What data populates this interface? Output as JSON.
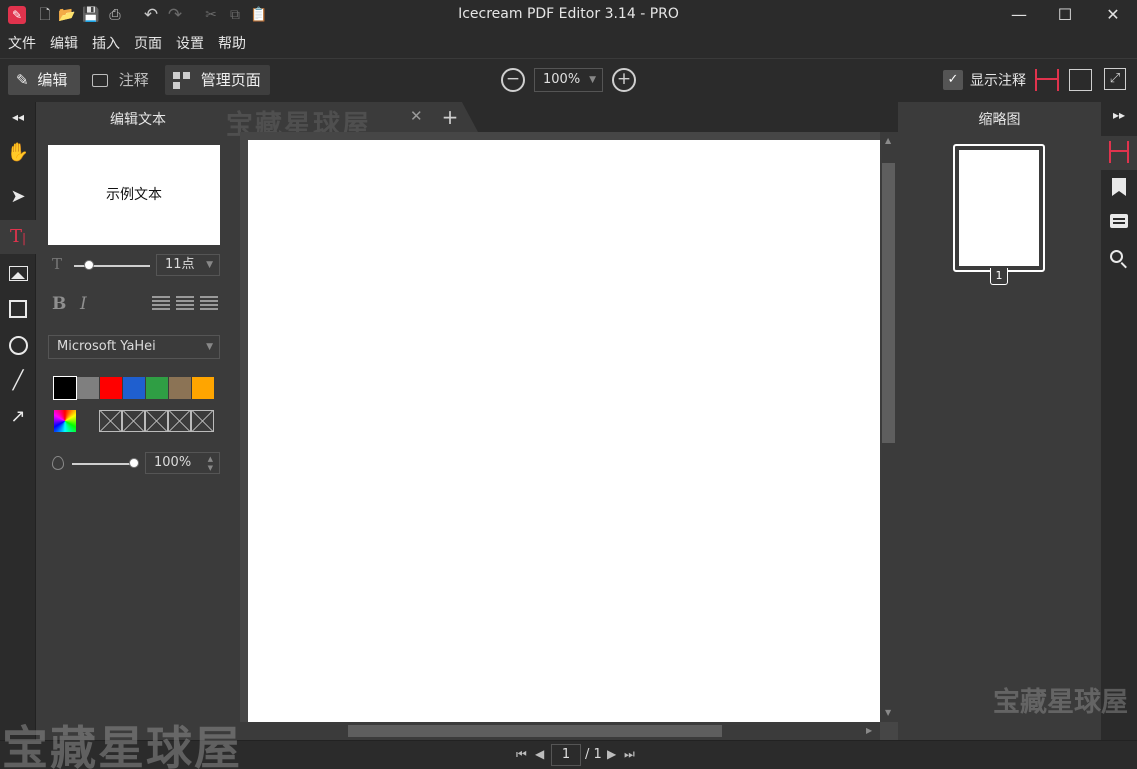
{
  "window": {
    "title": "Icecream PDF Editor 3.14 - PRO",
    "minimize": "—",
    "maximize": "☐",
    "close": "✕"
  },
  "quick_access": [
    "app-logo-icon",
    "new-file-icon",
    "open-folder-icon",
    "save-icon",
    "print-icon",
    "undo-icon",
    "redo-icon",
    "cut-icon",
    "copy-icon",
    "paste-icon"
  ],
  "menu": [
    "文件",
    "编辑",
    "插入",
    "页面",
    "设置",
    "帮助"
  ],
  "toolbar": {
    "edit_label": "编辑",
    "annotate_label": "注释",
    "manage_pages_label": "管理页面",
    "zoom_value": "100%",
    "zoom_out": "−",
    "zoom_in": "+",
    "show_annotations_label": "显示注释"
  },
  "tools": [
    "hand-icon",
    "select-arrow-icon",
    "text-tool-icon",
    "image-icon",
    "rectangle-icon",
    "ellipse-icon",
    "line-icon",
    "arrow-icon"
  ],
  "left_panel": {
    "collapse_glyph": "◂◂",
    "title": "编辑文本",
    "sample_text": "示例文本",
    "font_size_value": "11点",
    "font_size_level": 0.2,
    "bold_label": "B",
    "italic_label": "I",
    "font_family_value": "Microsoft YaHei",
    "colors": [
      "#000000",
      "#7f7f7f",
      "#ff0000",
      "#1f5fcf",
      "#2f9e44",
      "#8b7355",
      "#ffa500"
    ],
    "opacity_value": "100%",
    "opacity_level": 1.0
  },
  "tabs": {
    "active_close": "✕",
    "add": "+"
  },
  "right_panel": {
    "expand_glyph": "▸▸",
    "title": "缩略图",
    "thumb_page_number": "1"
  },
  "status": {
    "current_page": "1",
    "total_pages": "/ 1"
  },
  "watermarks": {
    "tab": "宝藏星球屋",
    "bottom_left": "宝藏星球屋",
    "bottom_right": "宝藏星球屋"
  },
  "colors": {
    "accent": "#e0334d",
    "background": "#2b2b2b",
    "panel": "#3b3b3b",
    "workspace": "#464646"
  }
}
